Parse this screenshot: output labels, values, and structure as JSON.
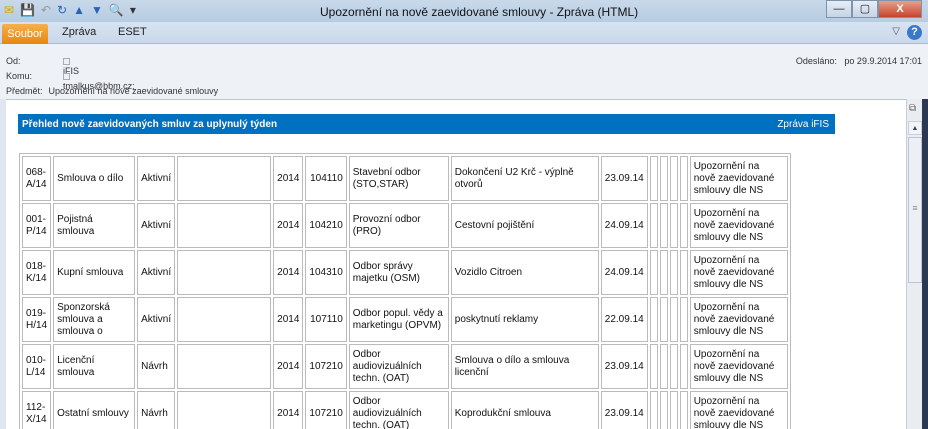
{
  "window": {
    "title": "Upozornění na nově zaevidované smlouvy  -  Zpráva (HTML)",
    "minimize": "—",
    "maximize": "▢",
    "close": "X"
  },
  "ribbon": {
    "tabs": [
      "Soubor",
      "Zpráva",
      "ESET"
    ],
    "help": "?",
    "minimize": "▽"
  },
  "header": {
    "from_label": "Od:",
    "from": "iFIS",
    "to_label": "Komu:",
    "to": "tmalkus@bbm.cz;",
    "subject_label": "Předmět:",
    "subject": "Upozornění na nově zaevidované smlouvy",
    "sent_label": "Odesláno:",
    "sent": "po 29.9.2014 17:01"
  },
  "message": {
    "banner_title": "Přehled nově zaevidovaných smluv za uplynulý týden",
    "banner_right": "Zpráva iFIS",
    "rows": [
      {
        "id": "068-A/14",
        "type": "Smlouva o dílo",
        "state": "Aktivní",
        "party": "",
        "year": "2014",
        "code": "104110",
        "dept": "Stavební odbor (STO,STAR)",
        "subject": "Dokončení U2 Krč - výplně otvorů",
        "date": "23.09.14",
        "note": "Upozornění na nově zaevidované smlouvy dle NS"
      },
      {
        "id": "001-P/14",
        "type": "Pojistná smlouva",
        "state": "Aktivní",
        "party": "",
        "year": "2014",
        "code": "104210",
        "dept": "Provozní odbor (PRO)",
        "subject": "Cestovní pojištění",
        "date": "24.09.14",
        "note": "Upozornění na nově zaevidované smlouvy dle NS"
      },
      {
        "id": "018-K/14",
        "type": "Kupní smlouva",
        "state": "Aktivní",
        "party": "",
        "year": "2014",
        "code": "104310",
        "dept": "Odbor správy majetku (OSM)",
        "subject": "Vozidlo Citroen",
        "date": "24.09.14",
        "note": "Upozornění na nově zaevidované smlouvy dle NS"
      },
      {
        "id": "019-H/14",
        "type": "Sponzorská smlouva a smlouva o",
        "state": "Aktivní",
        "party": "",
        "year": "2014",
        "code": "107110",
        "dept": "Odbor popul. vědy a marketingu (OPVM)",
        "subject": "poskytnutí reklamy",
        "date": "22.09.14",
        "note": "Upozornění na nově zaevidované smlouvy dle NS"
      },
      {
        "id": "010-L/14",
        "type": "Licenční smlouva",
        "state": "Návrh",
        "party": "",
        "year": "2014",
        "code": "107210",
        "dept": "Odbor audiovizuálních techn. (OAT)",
        "subject": "Smlouva o dílo a smlouva licenční",
        "date": "23.09.14",
        "note": "Upozornění na nově zaevidované smlouvy dle NS"
      },
      {
        "id": "112-X/14",
        "type": "Ostatní smlouvy",
        "state": "Návrh",
        "party": "",
        "year": "2014",
        "code": "107210",
        "dept": "Odbor audiovizuálních techn. (OAT)",
        "subject": "Koprodukční smlouva",
        "date": "23.09.14",
        "note": "Upozornění na nově zaevidované smlouvy dle NS"
      }
    ]
  },
  "colors": {
    "banner": "#0070c0",
    "file_tab": "#e78613"
  }
}
